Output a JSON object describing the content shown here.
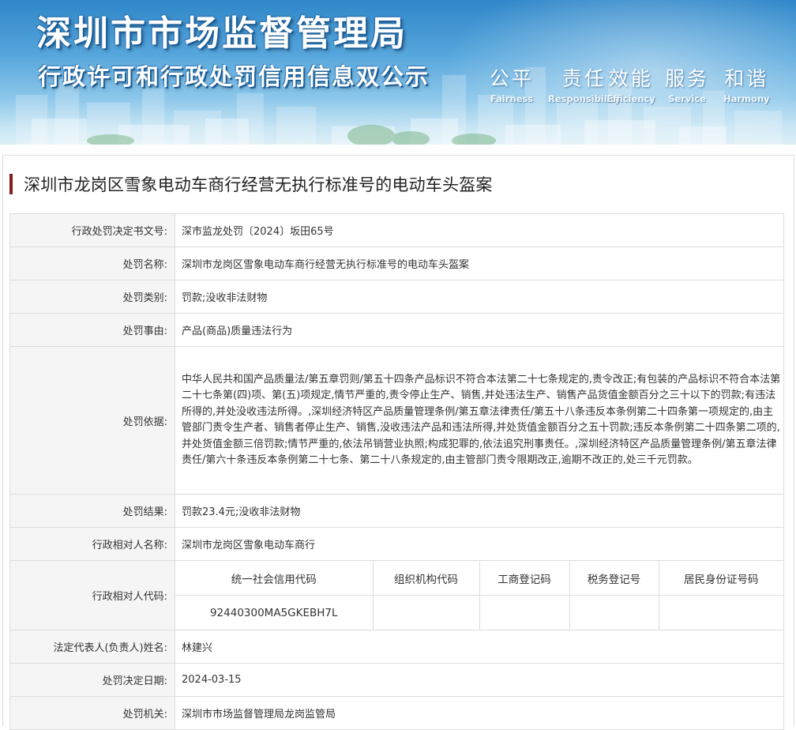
{
  "banner": {
    "title_main": "深圳市市场监督管理局",
    "title_sub": "行政许可和行政处罚信用信息双公示",
    "slogans": [
      {
        "cn": "公平",
        "en": "Fairness"
      },
      {
        "cn": "责任",
        "en": "Responsibility"
      },
      {
        "cn": "效能",
        "en": "Efficiency"
      },
      {
        "cn": "服务",
        "en": "Service"
      },
      {
        "cn": "和谐",
        "en": "Harmony"
      }
    ]
  },
  "case_title": "深圳市龙岗区雪象电动车商行经营无执行标准号的电动车头盔案",
  "fields": {
    "decision_no": {
      "label": "行政处罚决定书文号:",
      "value": "深市监龙处罚〔2024〕坂田65号"
    },
    "penalty_name": {
      "label": "处罚名称:",
      "value": "深圳市龙岗区雪象电动车商行经营无执行标准号的电动车头盔案"
    },
    "penalty_type": {
      "label": "处罚类别:",
      "value": "罚款;没收非法财物"
    },
    "penalty_reason": {
      "label": "处罚事由:",
      "value": "产品(商品)质量违法行为"
    },
    "penalty_basis": {
      "label": "处罚依据:",
      "value": "中华人民共和国产品质量法/第五章罚则/第五十四条产品标识不符合本法第二十七条规定的,责令改正;有包装的产品标识不符合本法第二十七条第(四)项、第(五)项规定,情节严重的,责令停止生产、销售,并处违法生产、销售产品货值金额百分之三十以下的罚款;有违法所得的,并处没收违法所得。,深圳经济特区产品质量管理条例/第五章法律责任/第五十八条违反本条例第二十四条第一项规定的,由主管部门责令生产者、销售者停止生产、销售,没收违法产品和违法所得,并处货值金额百分之五十罚款;违反本条例第二十四条第二项的,并处货值金额三倍罚款;情节严重的,依法吊销营业执照;构成犯罪的,依法追究刑事责任。,深圳经济特区产品质量管理条例/第五章法律责任/第六十条违反本条例第二十七条、第二十八条规定的,由主管部门责令限期改正,逾期不改正的,处三千元罚款。"
    },
    "penalty_result": {
      "label": "处罚结果:",
      "value": "罚款23.4元;没收非法财物"
    },
    "party_name": {
      "label": "行政相对人名称:",
      "value": "深圳市龙岗区雪象电动车商行"
    },
    "party_code": {
      "label": "行政相对人代码:",
      "headers": [
        "统一社会信用代码",
        "组织机构代码",
        "工商登记码",
        "税务登记号",
        "居民身份证号码"
      ],
      "values": [
        "92440300MA5GKEBH7L",
        "",
        "",
        "",
        ""
      ]
    },
    "legal_rep": {
      "label": "法定代表人(负责人)姓名:",
      "value": "林建兴"
    },
    "decision_date": {
      "label": "处罚决定日期:",
      "value": "2024-03-15"
    },
    "authority": {
      "label": "处罚机关:",
      "value": "深圳市市场监督管理局龙岗监管局"
    }
  },
  "colors": {
    "title_bar": "#8b1a1a",
    "label_bg": "#f5f5f5",
    "border": "#dddddd",
    "banner_top": "#2f86c9"
  }
}
